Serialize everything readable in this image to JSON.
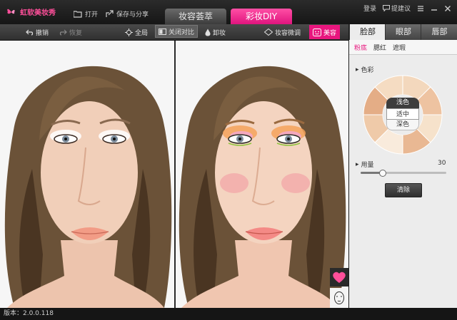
{
  "app": {
    "brand": "虹软美妆秀",
    "open_label": "打开",
    "save_share_label": "保存与分享",
    "tabs": [
      "妆容荟萃",
      "彩妆DIY"
    ],
    "login_label": "登录",
    "feedback_label": "提建议"
  },
  "toolbar": {
    "undo_label": "撤销",
    "redo_label": "恢复",
    "global_label": "全局",
    "compare_label": "关闭对比",
    "remove_makeup_label": "卸妆",
    "fine_tune_label": "妆容微调",
    "beauty_label": "美容"
  },
  "panel": {
    "tabs": [
      "脸部",
      "眼部",
      "唇部"
    ],
    "subtabs": [
      "粉底",
      "腮红",
      "遮瑕"
    ],
    "color_section": "色彩",
    "shade_options": [
      "浅色",
      "适中",
      "深色"
    ],
    "amount_label": "用量",
    "amount_value": "30",
    "amount_fraction": 0.25,
    "clear_label": "清除"
  },
  "status": {
    "version": "版本：2.0.0.118"
  },
  "colors": {
    "accent": "#e8167e",
    "foundation_shades": [
      "#f3d8bd",
      "#eec3a1",
      "#f6e2cb",
      "#e9b893",
      "#f9ebdc",
      "#efcaa9",
      "#e4ad86",
      "#f5dcc2"
    ]
  }
}
